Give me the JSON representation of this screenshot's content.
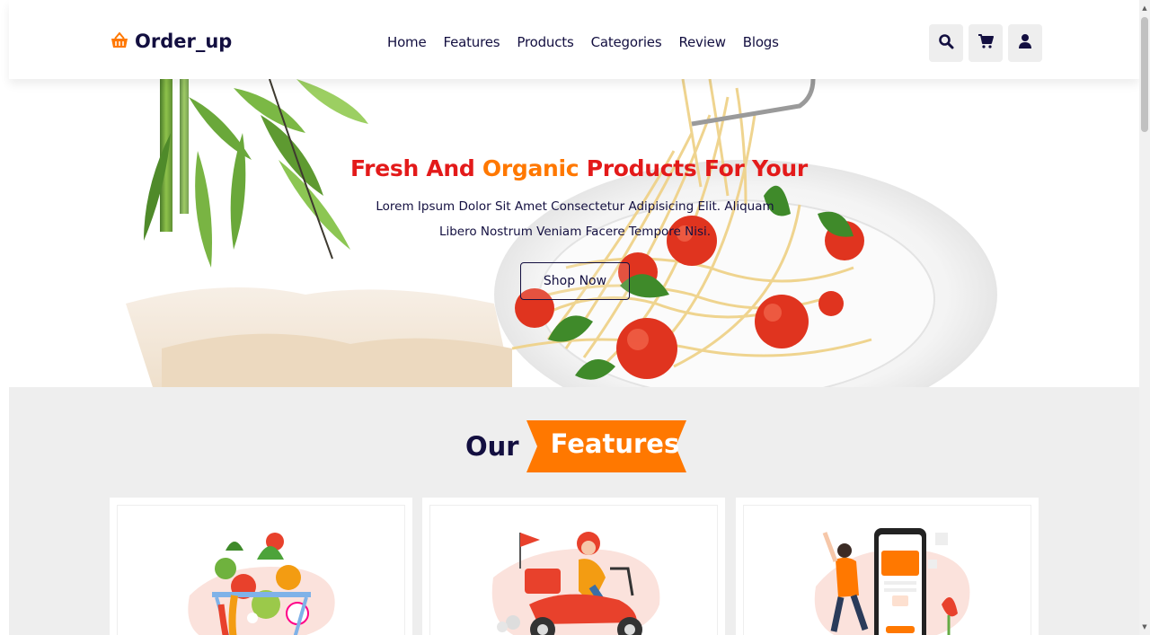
{
  "brand": {
    "name": "Order_up",
    "icon": "basket-icon"
  },
  "nav": [
    "Home",
    "Features",
    "Products",
    "Categories",
    "Review",
    "Blogs"
  ],
  "header_icons": [
    "search-icon",
    "cart-icon",
    "user-icon"
  ],
  "hero": {
    "title_part1": "Fresh And ",
    "title_highlight": "Organic",
    "title_part2": " Products For Your",
    "text": "Lorem Ipsum Dolor Sit Amet Consectetur Adipisicing Elit. Aliquam Libero Nostrum Veniam Facere Tempore Nisi.",
    "button": "Shop Now"
  },
  "features": {
    "heading_prefix": "Our",
    "heading_highlight": "Features",
    "cards": [
      "vegetable-basket-illustration",
      "delivery-scooter-illustration",
      "mobile-order-illustration"
    ]
  },
  "colors": {
    "accent": "#ff7800",
    "title_red": "#e31a1a",
    "dark": "#130f40",
    "section_bg": "#eeeeee"
  }
}
